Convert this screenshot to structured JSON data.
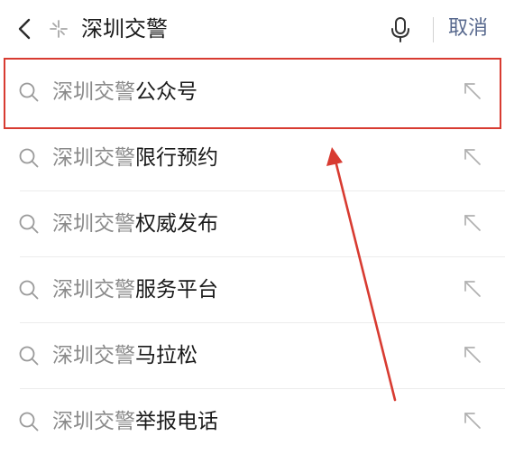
{
  "search_bar": {
    "query": "深圳交警",
    "cancel_label": "取消"
  },
  "suggestions": [
    {
      "query": "深圳交警",
      "completion": "公众号"
    },
    {
      "query": "深圳交警",
      "completion": "限行预约"
    },
    {
      "query": "深圳交警",
      "completion": "权威发布"
    },
    {
      "query": "深圳交警",
      "completion": "服务平台"
    },
    {
      "query": "深圳交警",
      "completion": "马拉松"
    },
    {
      "query": "深圳交警",
      "completion": "举报电话"
    }
  ],
  "colors": {
    "accent_link": "#58698e",
    "annotation_red": "#d83b31",
    "text_primary": "#1a1a1a",
    "text_muted": "#8a8a8a"
  },
  "icons": {
    "back": "back-chevron-icon",
    "spark": "spark-icon",
    "mic": "microphone-icon",
    "search": "search-icon",
    "fill_query": "fill-query-arrow-icon"
  }
}
